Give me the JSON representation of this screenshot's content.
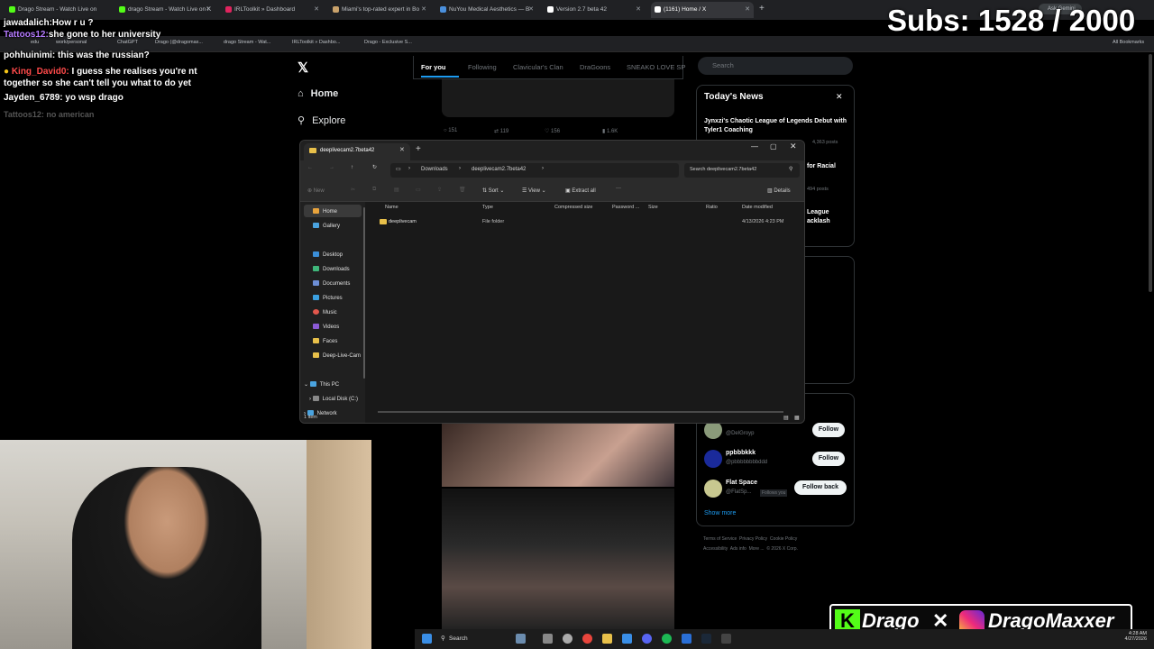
{
  "browser": {
    "tabs": [
      {
        "label": "Drago Stream - Watch Live on",
        "color": "#53fc18"
      },
      {
        "label": "drago Stream - Watch Live on K",
        "color": "#53fc18"
      },
      {
        "label": "IRLToolkit » Dashboard",
        "color": "#e0245e"
      },
      {
        "label": "Miami's top-rated expert in Bo",
        "color": "#c9a26b"
      },
      {
        "label": "NuYou Medical Aesthetics — B",
        "color": "#4a8fdc"
      },
      {
        "label": "Version 2.7 beta 42",
        "color": "#ffffff"
      },
      {
        "label": "(1161) Home / X",
        "color": "#ffffff"
      }
    ],
    "ask_gemini": "Ask Gemini",
    "bookmarks": [
      "edu",
      "work/personal",
      "ChatGPT",
      "Drago (@dragomax...",
      "drago Stream - Wat...",
      "IRLToolkit » Dashbo...",
      "Drago - Exclusive S..."
    ],
    "all_bookmarks": "All Bookmarks"
  },
  "overlay": {
    "subs": "Subs: 1528 / 2000",
    "chat": [
      {
        "user": "jawadalich:",
        "msg": "How r u ?",
        "color": "#ffffff"
      },
      {
        "user": "Tattoos12:",
        "msg": "she gone to her university",
        "color": "#b57bff"
      },
      {
        "user": "pohhuinimi:",
        "msg": "this was the russian?",
        "color": "#ffffff"
      },
      {
        "user": "King_David0:",
        "msg": "I guess she realises you're nt together so she can't tell you what to do yet",
        "color": "#ff4a4a"
      },
      {
        "user": "Jayden_6789:",
        "msg": "yo wsp drago",
        "color": "#ffffff"
      },
      {
        "user": "Tattoos12:",
        "msg": "no american",
        "color": "#888888"
      }
    ],
    "brand": {
      "kick": "Drago",
      "instagram": "DragoMaxxer"
    }
  },
  "x": {
    "nav": {
      "home": "Home",
      "explore": "Explore"
    },
    "feed_tabs": [
      "For you",
      "Following",
      "Clavicular's Clan",
      "DraGoons",
      "SNEAKO LOVE SP"
    ],
    "post_actions": [
      "151",
      "119",
      "156",
      "1.6K"
    ],
    "search_placeholder": "Search",
    "news": {
      "title": "Today's News",
      "headline1": "Jynxzi's Chaotic League of Legends Debut with Tyler1 Coaching",
      "posts1": "4,363 posts",
      "frag2": "for Racial",
      "posts2": "494 posts",
      "frag3": "League",
      "frag3b": "acklash"
    },
    "follow": [
      {
        "name": "",
        "handle": "@DelGroyp",
        "btn": "Follow"
      },
      {
        "name": "ppbbbkkk",
        "handle": "@pbbbbbbbbddd",
        "btn": "Follow"
      },
      {
        "name": "Flat Space",
        "handle": "@FlatSp...",
        "tag": "Follows you",
        "btn": "Follow back"
      }
    ],
    "show_more": "Show more",
    "footer": [
      "Terms of Service",
      "Privacy Policy",
      "Cookie Policy",
      "Accessibility",
      "Ads info",
      "More ...",
      "© 2026 X Corp."
    ]
  },
  "explorer": {
    "tab_title": "deeplivecam2.7beta42",
    "breadcrumb": [
      "Downloads",
      "deeplivecam2.7beta42"
    ],
    "search_placeholder": "Search deeplivecam2.7beta42",
    "cmd": {
      "new": "New",
      "sort": "Sort",
      "view": "View",
      "extract": "Extract all",
      "details": "Details"
    },
    "sidebar": [
      {
        "label": "Home",
        "color": "#e8a33c"
      },
      {
        "label": "Gallery",
        "color": "#4aa3df"
      },
      {
        "label": "Desktop",
        "color": "#3b8fd9"
      },
      {
        "label": "Downloads",
        "color": "#3fb67a"
      },
      {
        "label": "Documents",
        "color": "#6d8fd6"
      },
      {
        "label": "Pictures",
        "color": "#3ba0e0"
      },
      {
        "label": "Music",
        "color": "#e2574c"
      },
      {
        "label": "Videos",
        "color": "#8c5bd6"
      },
      {
        "label": "Faces",
        "color": "#e8c04a"
      },
      {
        "label": "Deep-Live-Cam",
        "color": "#e8c04a"
      }
    ],
    "tree": {
      "this_pc": "This PC",
      "local_disk": "Local Disk (C:)",
      "network": "Network"
    },
    "columns": [
      "Name",
      "Type",
      "Compressed size",
      "Password ...",
      "Size",
      "Ratio",
      "Date modified"
    ],
    "rows": [
      {
        "name": "deeplivecam",
        "type": "File folder",
        "date": "4/13/2026 4:23 PM"
      }
    ],
    "status": "1 item"
  },
  "taskbar": {
    "search": "Search",
    "time": "4:28 AM",
    "date": "4/27/2026"
  }
}
